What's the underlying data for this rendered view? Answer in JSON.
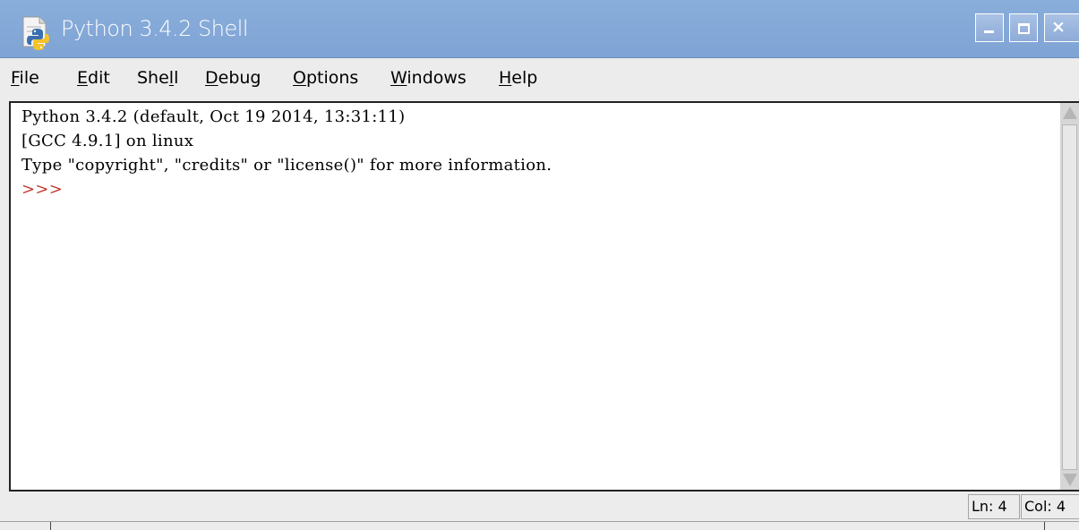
{
  "window": {
    "title": "Python 3.4.2 Shell",
    "icon": "python-app-icon",
    "controls": {
      "minimize": "minimize-icon",
      "maximize": "maximize-icon",
      "close": "close-icon"
    }
  },
  "menubar": {
    "items": [
      {
        "before": "",
        "mnemonic": "F",
        "after": "ile"
      },
      {
        "before": "",
        "mnemonic": "E",
        "after": "dit"
      },
      {
        "before": "She",
        "mnemonic": "l",
        "after": "l"
      },
      {
        "before": "",
        "mnemonic": "D",
        "after": "ebug"
      },
      {
        "before": "",
        "mnemonic": "O",
        "after": "ptions"
      },
      {
        "before": "",
        "mnemonic": "W",
        "after": "indows"
      },
      {
        "before": "",
        "mnemonic": "H",
        "after": "elp"
      }
    ]
  },
  "shell": {
    "lines": [
      "Python 3.4.2 (default, Oct 19 2014, 13:31:11)",
      "[GCC 4.9.1] on linux",
      "Type \"copyright\", \"credits\" or \"license()\" for more information."
    ],
    "prompt": ">>>",
    "prompt_color": "#c0362c"
  },
  "statusbar": {
    "line": "Ln: 4",
    "column": "Col: 4"
  },
  "colors": {
    "titlebar": "#7fa3d4",
    "background": "#ececec",
    "editor_background": "#ffffff"
  }
}
